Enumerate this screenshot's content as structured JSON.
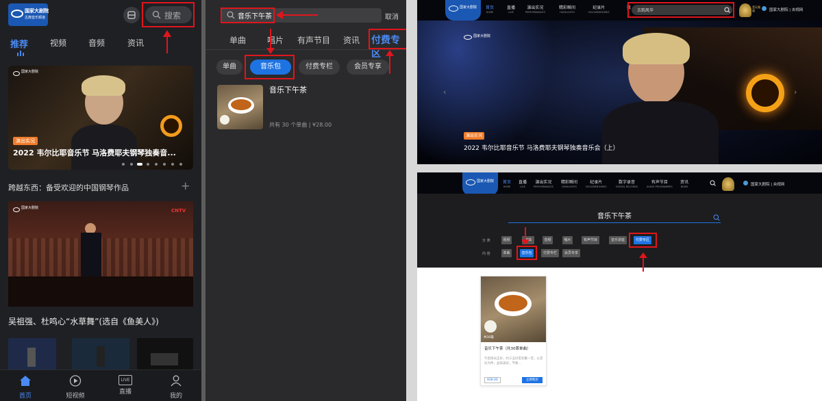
{
  "mobile_home": {
    "logo_title": "国家大剧院",
    "logo_sub": "古典音乐频道",
    "search_label": "搜索",
    "tabs": [
      "推荐",
      "视频",
      "音频",
      "资讯"
    ],
    "banner_badge": "演出实况",
    "banner_title": "2022 韦尔比耶音乐节 马洛费耶夫钢琴独奏音...",
    "section_title": "跨越东西：备受欢迎的中国钢琴作品",
    "add_symbol": "+",
    "video_channel": "CNTV",
    "video_title": "吴祖强、杜鸣心“水草舞”(选自《鱼美人》)",
    "nav": [
      "首页",
      "短视频",
      "直播",
      "我的"
    ],
    "live_text": "LIVE"
  },
  "mobile_search": {
    "query": "音乐下午茶",
    "cancel": "取消",
    "tabs": [
      "单曲",
      "唱片",
      "有声节目",
      "资讯",
      "付费专区"
    ],
    "chips": [
      "单曲",
      "音乐包",
      "付费专栏",
      "会员专享"
    ],
    "result_title": "音乐下午茶",
    "result_meta": "共有 30 个单曲 | ¥28.00"
  },
  "desktop_home": {
    "nav": [
      {
        "cn": "首页",
        "en": "HOME"
      },
      {
        "cn": "直播",
        "en": "LIVE"
      },
      {
        "cn": "演出实况",
        "en": "PERFORMANCES"
      },
      {
        "cn": "精彩瞬间",
        "en": "HIGHLIGHTS"
      },
      {
        "cn": "纪录片",
        "en": "DOCUMENTARIES"
      },
      {
        "cn": "数",
        "en": ""
      }
    ],
    "search_value": "古韵风华",
    "right_links": "国家大剧院 | 央视网",
    "award_text": "音乐频道",
    "badge": "演出实况",
    "title": "2022 韦尔比耶音乐节 马洛费耶夫钢琴独奏音乐会（上）",
    "prev": "‹",
    "next": "›"
  },
  "desktop_search": {
    "nav": [
      {
        "cn": "首页",
        "en": "HOME"
      },
      {
        "cn": "直播",
        "en": "LIVE"
      },
      {
        "cn": "演出实况",
        "en": "PERFORMANCES"
      },
      {
        "cn": "精彩瞬间",
        "en": "HIGHLIGHTS"
      },
      {
        "cn": "纪录片",
        "en": "DOCUMENTARIES"
      },
      {
        "cn": "数字录音",
        "en": "DIGITAL RECORDS"
      },
      {
        "cn": "有声节目",
        "en": "AUDIO PROGRAMMES"
      },
      {
        "cn": "资讯",
        "en": "NEWS"
      }
    ],
    "right_links": "国家大剧院 | 央视网",
    "query": "音乐下午茶",
    "row1_label": "分 类",
    "row1": [
      "视频",
      "单曲",
      "音频",
      "唱片",
      "有声节目",
      "音乐讲座",
      "付费专区"
    ],
    "row2_label": "内 容",
    "row2": [
      "单曲",
      "音乐包",
      "付费专栏",
      "会员专享"
    ],
    "card_count": "共30篇",
    "card_title": "音乐下午茶（共30首单曲）",
    "card_desc": "午后阳光正好，约三五好友欢聚一堂，以音乐为伴，品味美好。节奏...",
    "card_price": "¥28.00",
    "card_button": "立即购买"
  },
  "colors": {
    "accent": "#1e73e3",
    "highlight": "#e0161c",
    "badge": "#f07c2a"
  }
}
